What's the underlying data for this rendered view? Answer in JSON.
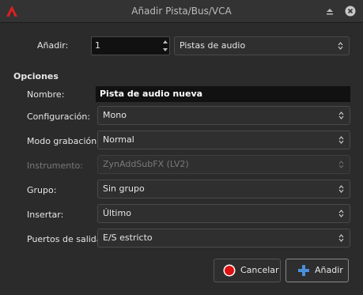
{
  "window": {
    "title": "Añadir Pista/Bus/VCA"
  },
  "icons": {
    "app": "ardour-logo-icon",
    "minimize": "minimize-icon",
    "close": "close-icon"
  },
  "add_row": {
    "label": "Añadir:",
    "count": "1",
    "type_value": "Pistas de audio"
  },
  "options": {
    "heading": "Opciones",
    "name": {
      "label": "Nombre:",
      "value": "Pista de audio nueva"
    },
    "configuration": {
      "label": "Configuración:",
      "value": "Mono"
    },
    "record_mode": {
      "label": "Modo grabación:",
      "value": "Normal"
    },
    "instrument": {
      "label": "Instrumento:",
      "value": "ZynAddSubFX (LV2)",
      "enabled": false
    },
    "group": {
      "label": "Grupo:",
      "value": "Sin grupo"
    },
    "insert": {
      "label": "Insertar:",
      "value": "Último"
    },
    "output_ports": {
      "label": "Puertos de salida:",
      "value": "E/S estricto"
    }
  },
  "buttons": {
    "cancel": {
      "label": "Cancelar",
      "icon": "cancel-icon"
    },
    "add": {
      "label": "Añadir",
      "icon": "plus-icon"
    }
  },
  "colors": {
    "background": "#2b2b2b",
    "accent_red": "#d11",
    "add_icon_blue": "#4a8fd9"
  }
}
